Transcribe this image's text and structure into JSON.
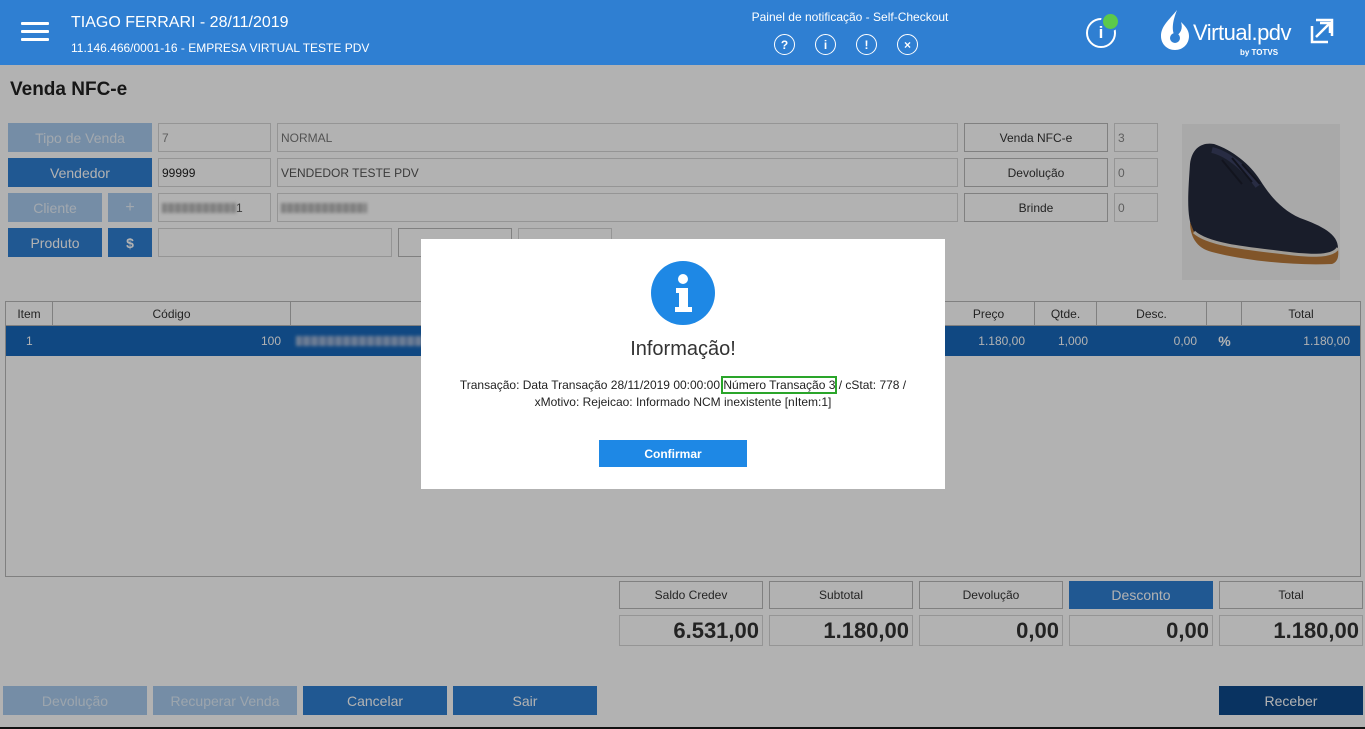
{
  "header": {
    "user_title": "TIAGO FERRARI - 28/11/2019",
    "company": "11.146.466/0001-16 - EMPRESA VIRTUAL TESTE PDV",
    "notif_title": "Painel de notificação - Self-Checkout",
    "notif_icons": [
      "?",
      "i",
      "!",
      "×"
    ],
    "info_icon": "i",
    "logo_text": "Virtual.pdv",
    "logo_sub": "by TOTVS",
    "colors": {
      "bar": "#2f7fd2",
      "status_dot": "#5cc94a"
    }
  },
  "page": {
    "title": "Venda NFC-e"
  },
  "form": {
    "tipo_venda_label": "Tipo de Venda",
    "tipo_venda_code": "7",
    "tipo_venda_desc": "NORMAL",
    "vendedor_label": "Vendedor",
    "vendedor_code": "99999",
    "vendedor_desc": "VENDEDOR TESTE PDV",
    "cliente_label": "Cliente",
    "cliente_add": "+",
    "cliente_code_suffix": "1",
    "produto_label": "Produto",
    "price_button": "$",
    "venda_nfce_label": "Venda NFC-e",
    "venda_nfce_value": "3",
    "devolucao_label": "Devolução",
    "devolucao_value": "0",
    "brinde_label": "Brinde",
    "brinde_value": "0"
  },
  "table": {
    "headers": [
      "Item",
      "Código",
      "Preço",
      "Qtde.",
      "Desc.",
      "Total"
    ],
    "rows": [
      {
        "item": "1",
        "codigo": "100",
        "preco": "1.180,00",
        "qtde": "1,000",
        "desc": "0,00",
        "action": "%",
        "total": "1.180,00"
      }
    ]
  },
  "totals": {
    "labels": [
      "Saldo Credev",
      "Subtotal",
      "Devolução",
      "Desconto",
      "Total"
    ],
    "values": [
      "6.531,00",
      "1.180,00",
      "0,00",
      "0,00",
      "1.180,00"
    ]
  },
  "bottom_buttons": {
    "devolucao": "Devolução",
    "recuperar": "Recuperar Venda",
    "cancelar": "Cancelar",
    "sair": "Sair",
    "receber": "Receber"
  },
  "modal": {
    "icon": "i",
    "title": "Informação!",
    "message_part1": "Transação: Data Transação 28/11/2019 00:00:00 ",
    "message_highlight": "Número Transação 3",
    "message_part2": " / cStat: 778 / xMotivo: Rejeicao: Informado NCM inexistente [nItem:1]",
    "confirm_label": "Confirmar",
    "colors": {
      "accent": "#1e88e5",
      "highlight_border": "#2aa52a"
    }
  }
}
